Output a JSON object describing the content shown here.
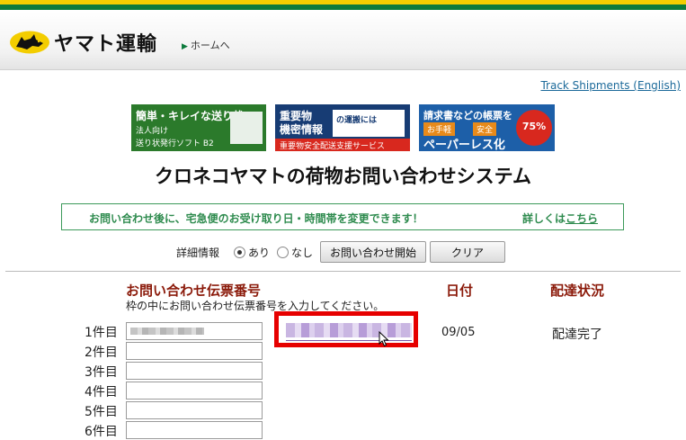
{
  "header": {
    "brand": "ヤマト運輸",
    "home_link": "ホームへ"
  },
  "track_link": "Track Shipments (English)",
  "banners": [
    {
      "line1": "簡単・キレイな送り状",
      "line2": "法人向け",
      "line3": "送り状発行ソフト B2"
    },
    {
      "line1": "重要物",
      "line2": "機密情報",
      "line3": "重要物安全配送支援サービス",
      "card": "の運搬には"
    },
    {
      "line1": "請求書などの帳票を",
      "pill1": "お手軽",
      "pill2": "安全",
      "line3": "ペーパーレス化",
      "badge": "75%"
    }
  ],
  "page_title": "クロネコヤマトの荷物お問い合わせシステム",
  "notice": {
    "message": "お問い合わせ後に、宅急便のお受け取り日・時間帯を変更できます！",
    "more_prefix": "詳しくは",
    "more_link": "こちら"
  },
  "options": {
    "label": "詳細情報",
    "yes": "あり",
    "no": "なし",
    "selected": "あり",
    "search_button": "お問い合わせ開始",
    "clear_button": "クリア"
  },
  "table": {
    "head_number": "お問い合わせ伝票番号",
    "head_date": "日付",
    "head_status": "配達状況",
    "hint": "枠の中にお問い合わせ伝票番号を入力してください。",
    "rows": [
      {
        "label": "1件目",
        "date": "09/05",
        "status": "配達完了"
      },
      {
        "label": "2件目"
      },
      {
        "label": "3件目"
      },
      {
        "label": "4件目"
      },
      {
        "label": "5件目"
      },
      {
        "label": "6件目"
      }
    ]
  },
  "colors": {
    "brand_green": "#0c7a3b",
    "brand_yellow": "#f3cd00",
    "heading_red": "#8b1a0a",
    "highlight_red": "#e60000",
    "notice_green": "#2e8b4e"
  }
}
